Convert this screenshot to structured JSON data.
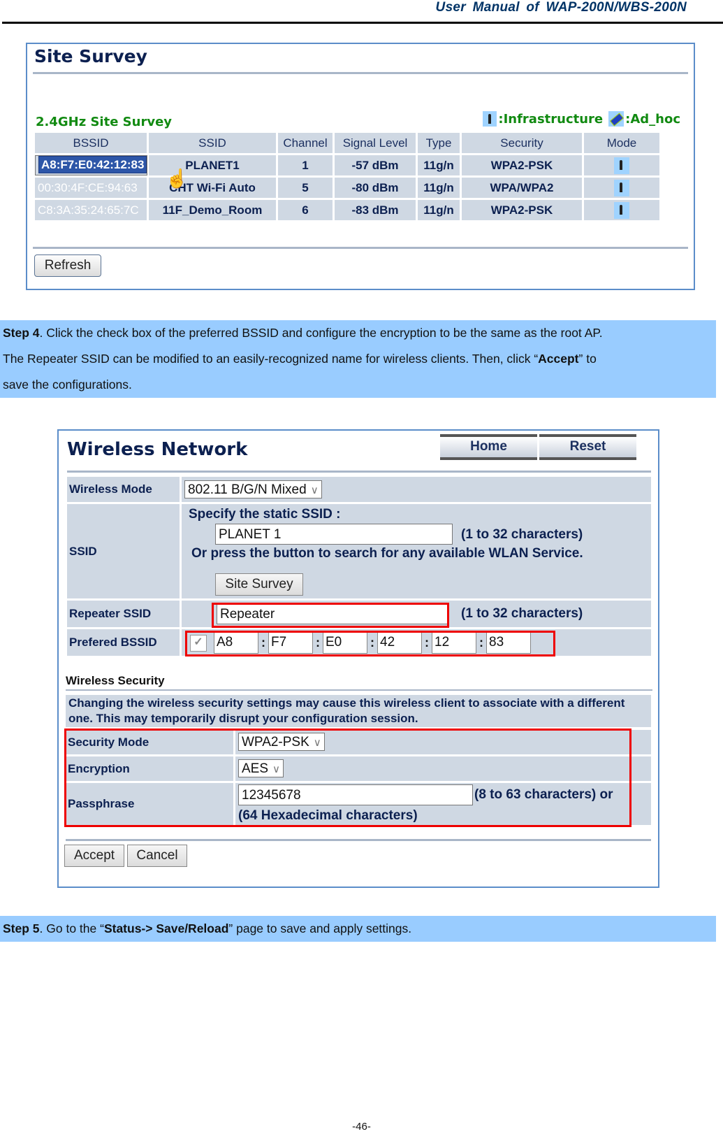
{
  "header": {
    "title": "User  Manual  of  WAP-200N/WBS-200N"
  },
  "site_survey": {
    "title": "Site Survey",
    "subtitle": "2.4GHz Site Survey",
    "legend": {
      "infrastructure_label": ":Infrastructure",
      "adhoc_label": ":Ad_hoc"
    },
    "columns": [
      "BSSID",
      "SSID",
      "Channel",
      "Signal Level",
      "Type",
      "Security",
      "Mode"
    ],
    "rows": [
      {
        "bssid": "A8:F7:E0:42:12:83",
        "ssid": "PLANET1",
        "channel": "1",
        "signal": "-57 dBm",
        "type": "11g/n",
        "security": "WPA2-PSK",
        "mode": "infrastructure",
        "selected": true
      },
      {
        "bssid": "00:30:4F:CE:94:63",
        "ssid": "CHT Wi-Fi Auto",
        "channel": "5",
        "signal": "-80 dBm",
        "type": "11g/n",
        "security": "WPA/WPA2",
        "mode": "infrastructure",
        "selected": false
      },
      {
        "bssid": "C8:3A:35:24:65:7C",
        "ssid": "11F_Demo_Room",
        "channel": "6",
        "signal": "-83 dBm",
        "type": "11g/n",
        "security": "WPA2-PSK",
        "mode": "infrastructure",
        "selected": false
      }
    ],
    "refresh_label": "Refresh"
  },
  "step4": {
    "step_label": "Step 4",
    "line1": ". Click the check box of the preferred BSSID and configure the encryption to be the same as the root AP.",
    "line2_pre": "The Repeater SSID can be modified to an easily-recognized name for wireless clients. Then, click “",
    "line2_bold": "Accept",
    "line2_post": "” to",
    "line3": "save the configurations."
  },
  "wireless_network": {
    "title": "Wireless Network",
    "home_label": "Home",
    "reset_label": "Reset",
    "wireless_mode": {
      "label": "Wireless Mode",
      "value": "802.11 B/G/N Mixed"
    },
    "ssid": {
      "label": "SSID",
      "specify_text": "Specify the static SSID  :",
      "value": "PLANET 1",
      "hint": "(1 to 32 characters)",
      "search_text": "Or press the button to search for any available WLAN Service.",
      "site_survey_label": "Site Survey"
    },
    "repeater_ssid": {
      "label": "Repeater SSID",
      "value": "Repeater",
      "hint": "(1 to 32 characters)"
    },
    "prefered_bssid": {
      "label": "Prefered BSSID",
      "checked": true,
      "octets": [
        "A8",
        "F7",
        "E0",
        "42",
        "12",
        "83"
      ],
      "separator": ":"
    },
    "security": {
      "section_title": "Wireless Security",
      "warning": "Changing the wireless security settings may cause this wireless client to associate with a different one. This may temporarily disrupt your configuration session.",
      "security_mode": {
        "label": "Security Mode",
        "value": "WPA2-PSK"
      },
      "encryption": {
        "label": "Encryption",
        "value": "AES"
      },
      "passphrase": {
        "label": "Passphrase",
        "value": "12345678",
        "hint1": "(8 to 63 characters) or",
        "hint2": "(64 Hexadecimal characters)"
      }
    },
    "accept_label": "Accept",
    "cancel_label": "Cancel"
  },
  "step5": {
    "step_label": "Step 5",
    "pre": ". Go to the “",
    "bold": "Status-> Save/Reload",
    "post": "” page to save and apply settings."
  },
  "footer": {
    "page_number": "-46-"
  },
  "colors": {
    "highlight_band": "#99ccff",
    "annotation_red": "#ee0000",
    "survey_green": "#118a11",
    "title_navy": "#0c2050"
  }
}
